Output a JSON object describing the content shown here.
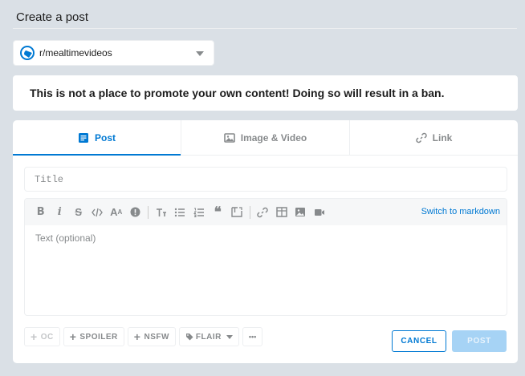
{
  "header": {
    "title": "Create a post"
  },
  "community": {
    "name": "r/mealtimevideos"
  },
  "banner": {
    "text": "This is not a place to promote your own content! Doing so will result in a ban."
  },
  "tabs": [
    {
      "label": "Post",
      "icon": "post-icon",
      "active": true
    },
    {
      "label": "Image & Video",
      "icon": "image-icon",
      "active": false
    },
    {
      "label": "Link",
      "icon": "link-icon",
      "active": false
    }
  ],
  "title_input": {
    "placeholder": "Title",
    "value": ""
  },
  "editor": {
    "placeholder": "Text (optional)",
    "switch_label": "Switch to markdown",
    "toolbar_icons": [
      "bold-icon",
      "italic-icon",
      "strikethrough-icon",
      "inline-code-icon",
      "superscript-icon",
      "spoiler-icon",
      "heading-icon",
      "bulleted-list-icon",
      "numbered-list-icon",
      "quote-block-icon",
      "code-block-icon",
      "link-icon",
      "table-icon",
      "image-icon",
      "video-icon"
    ]
  },
  "footer": {
    "oc": "OC",
    "spoiler": "SPOILER",
    "nsfw": "NSFW",
    "flair": "FLAIR",
    "more": "•••",
    "cancel": "CANCEL",
    "post": "POST"
  },
  "colors": {
    "accent": "#0079d3",
    "page_bg": "#dae0e6",
    "muted": "#878a8c"
  }
}
